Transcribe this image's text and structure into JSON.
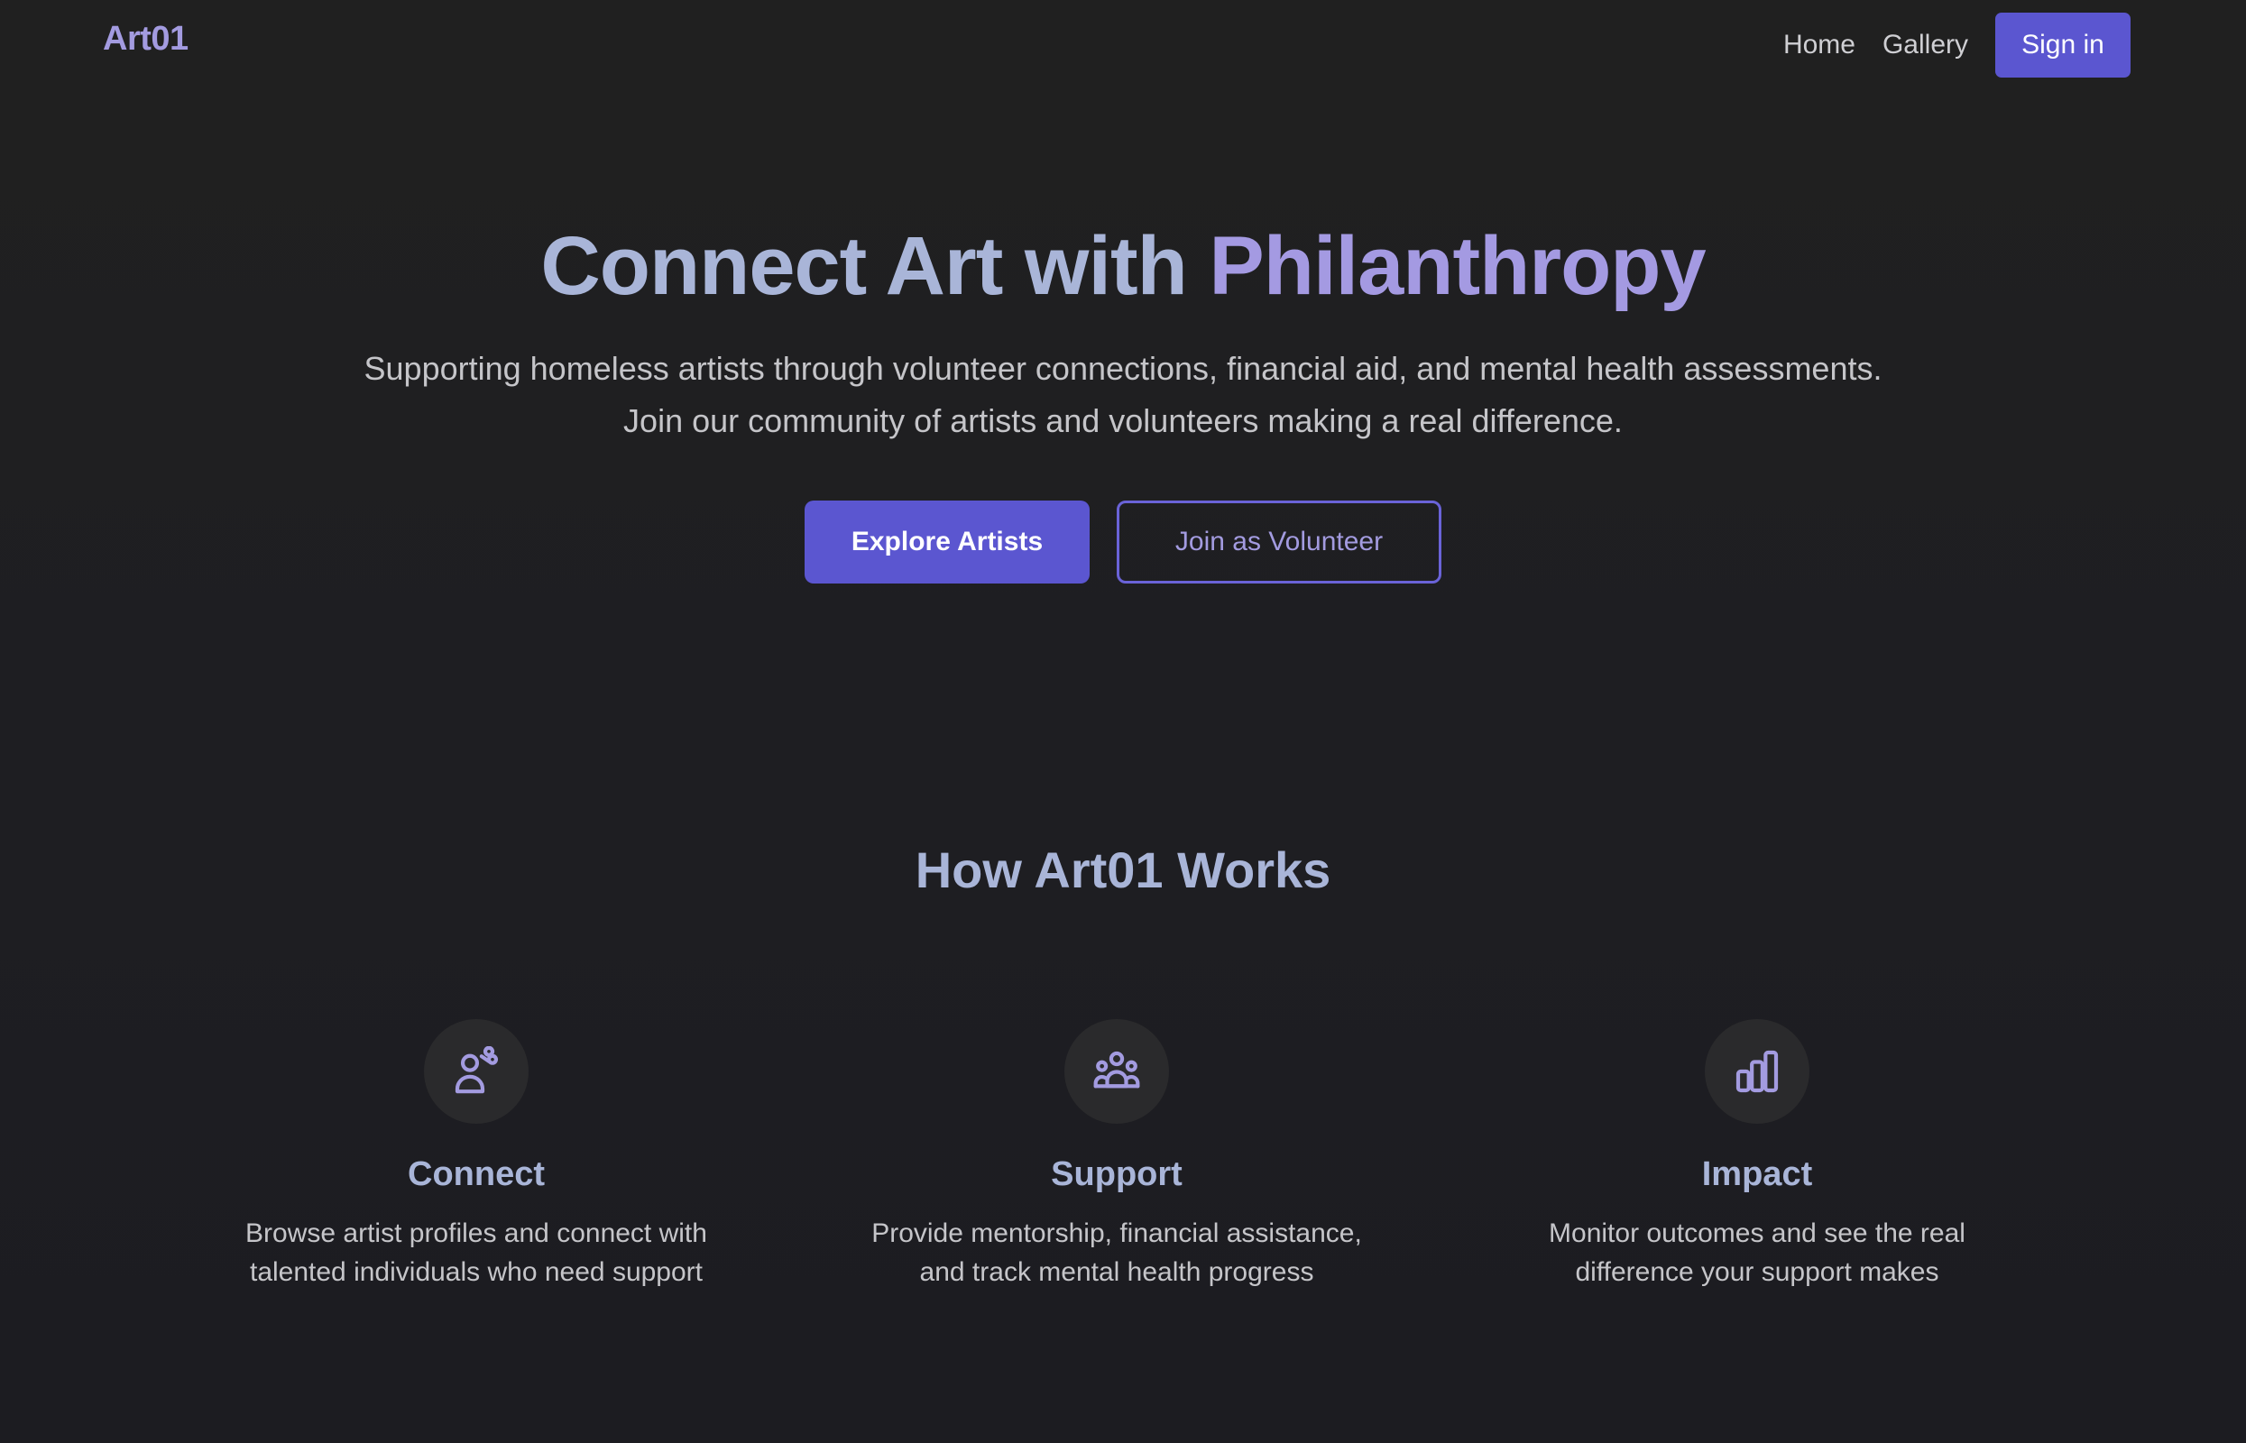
{
  "header": {
    "logo": "Art01",
    "nav": {
      "home": "Home",
      "gallery": "Gallery",
      "signin": "Sign in"
    }
  },
  "hero": {
    "title_part1": "Connect Art with ",
    "title_part2": "Philanthropy",
    "subtitle": "Supporting homeless artists through volunteer connections, financial aid, and mental health assessments. Join our community of artists and volunteers making a real difference.",
    "primary_cta": "Explore Artists",
    "secondary_cta": "Join as Volunteer"
  },
  "how_it_works": {
    "title": "How Art01 Works",
    "features": [
      {
        "icon": "user-connect-icon",
        "title": "Connect",
        "description": "Browse artist profiles and connect with talented individuals who need support"
      },
      {
        "icon": "users-group-icon",
        "title": "Support",
        "description": "Provide mentorship, financial assistance, and track mental health progress"
      },
      {
        "icon": "bar-chart-icon",
        "title": "Impact",
        "description": "Monitor outcomes and see the real difference your support makes"
      }
    ]
  },
  "colors": {
    "background": "#1f1f22",
    "accent": "#5b56d0",
    "accent_light": "#a39be0",
    "heading": "#a9b5d8",
    "text": "#c5c5c9",
    "icon_bg": "#2a2a2c"
  }
}
